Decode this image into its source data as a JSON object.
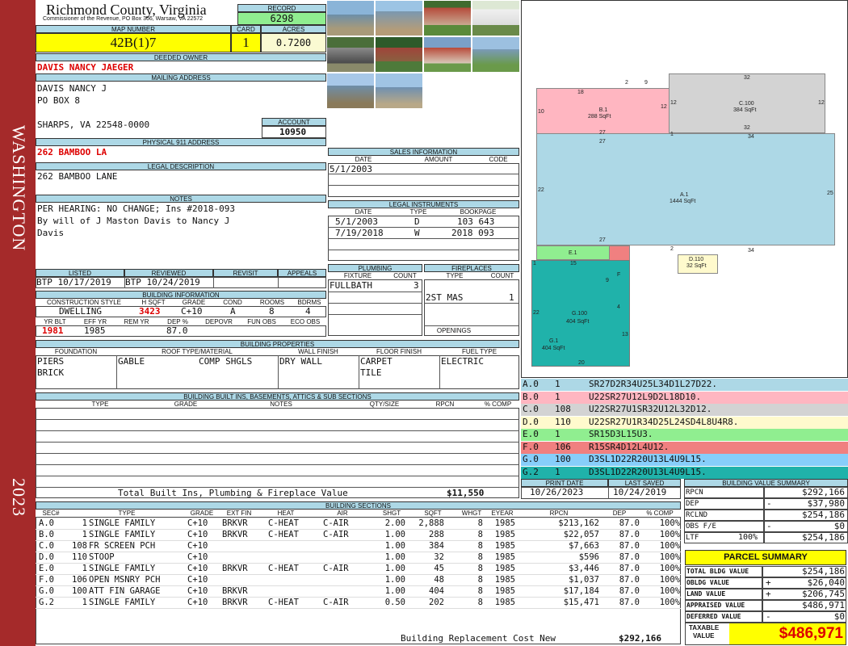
{
  "county": {
    "name": "Richmond County, Virginia",
    "address": "Commissioner of the Revenue, PO Box 366, Warsaw, VA 22572"
  },
  "side": {
    "district": "WASHINGTON",
    "year": "2023"
  },
  "record": {
    "label": "RECORD",
    "value": "6298"
  },
  "map": {
    "label": "MAP NUMBER",
    "value": "42B(1)7"
  },
  "card": {
    "label": "CARD",
    "value": "1"
  },
  "acres": {
    "label": "ACRES",
    "value": "0.7200"
  },
  "owner": {
    "label": "DEEDED OWNER",
    "value": "DAVIS NANCY JAEGER"
  },
  "mailing": {
    "label": "MAILING ADDRESS",
    "line1": "DAVIS NANCY J",
    "line2": "PO BOX 8",
    "line3": "SHARPS, VA 22548-0000"
  },
  "account": {
    "label": "ACCOUNT",
    "value": "10950"
  },
  "physical": {
    "label": "PHYSICAL 911 ADDRESS",
    "value": "262 BAMBOO LA"
  },
  "legal": {
    "label": "LEGAL DESCRIPTION",
    "value": "262 BAMBOO LANE"
  },
  "notes": {
    "label": "NOTES",
    "line1": "PER HEARING: NO CHANGE; Ins #2018-093",
    "line2": "By will of J Maston Davis to Nancy J",
    "line3": "Davis"
  },
  "sales": {
    "label": "SALES INFORMATION",
    "h_date": "DATE",
    "h_amount": "AMOUNT",
    "h_code": "CODE",
    "r1_date": "5/1/2003"
  },
  "instruments": {
    "label": "LEGAL INSTRUMENTS",
    "h_date": "DATE",
    "h_type": "TYPE",
    "h_bp": "BOOKPAGE",
    "rows": [
      {
        "date": "5/1/2003",
        "type": "D",
        "bp": "103 643"
      },
      {
        "date": "7/19/2018",
        "type": "W",
        "bp": "2018 093"
      }
    ]
  },
  "listed": {
    "label": "LISTED",
    "value": "BTP 10/17/2019"
  },
  "reviewed": {
    "label": "REVIEWED",
    "value": "BTP 10/24/2019"
  },
  "revisit": {
    "label": "REVISIT"
  },
  "appeals": {
    "label": "APPEALS"
  },
  "binfo": {
    "label": "BUILDING INFORMATION",
    "h_cs": "CONSTRUCTION STYLE",
    "h_sq": "H SQFT",
    "h_grade": "GRADE",
    "h_cond": "COND",
    "h_rooms": "ROOMS",
    "h_bdrms": "BDRMS",
    "cs": "DWELLING",
    "sq": "3423",
    "grade": "C+10",
    "cond": "A",
    "rooms": "8",
    "bdrms": "4",
    "h_yb": "YR BLT",
    "h_ey": "EFF YR",
    "h_rem": "REM YR",
    "h_dep": "DEP %",
    "h_depovr": "DEPOVR",
    "h_fun": "FUN OBS",
    "h_eco": "ECO OBS",
    "yb": "1981",
    "ey": "1985",
    "dep": "87.0"
  },
  "plumbing": {
    "label": "PLUMBING",
    "h_fixture": "FIXTURE",
    "h_count": "COUNT",
    "fixture": "FULLBATH",
    "count": "3"
  },
  "fireplaces": {
    "label": "FIREPLACES",
    "h_type": "TYPE",
    "h_count": "COUNT",
    "type": "2ST MAS",
    "count": "1",
    "openings": "OPENINGS"
  },
  "props": {
    "label": "BUILDING PROPERTIES",
    "h_found": "FOUNDATION",
    "h_roof": "ROOF TYPE/MATERIAL",
    "h_wall": "WALL FINISH",
    "h_floor": "FLOOR FINISH",
    "h_fuel": "FUEL TYPE",
    "found1": "PIERS",
    "found2": "BRICK",
    "roof1": "GABLE",
    "roof2": "COMP SHGLS",
    "wall": "DRY WALL",
    "floor1": "CARPET",
    "floor2": "TILE",
    "fuel": "ELECTRIC"
  },
  "builtins": {
    "label": "BUILDING BUILT INS, BASEMENTS, ATTICS & SUB SECTIONS",
    "h_type": "TYPE",
    "h_grade": "GRADE",
    "h_notes": "NOTES",
    "h_qty": "QTY/SIZE",
    "h_rpcn": "RPCN",
    "h_pc": "% COMP",
    "total_label": "Total Built Ins, Plumbing & Fireplace Value",
    "total": "$11,550"
  },
  "sketch": {
    "areas": [
      {
        "code": "B.1",
        "sqft": "288 SqFt"
      },
      {
        "code": "C.100",
        "sqft": "384 SqFt"
      },
      {
        "code": "A.1",
        "sqft": "1444 SqFt"
      },
      {
        "code": "D.110",
        "sqft": "32 SqFt"
      },
      {
        "code": "E.1",
        "sqft": ""
      },
      {
        "code": "F",
        "sqft": ""
      },
      {
        "code": "G.100",
        "sqft": "404 SqFt"
      },
      {
        "code": "G.1",
        "sqft": "404 SqFt"
      }
    ],
    "dims": [
      "18",
      "2",
      "9",
      "10",
      "12",
      "27",
      "32",
      "12",
      "12",
      "32",
      "1",
      "27",
      "34",
      "22",
      "25",
      "27",
      "2",
      "34",
      "1",
      "15",
      "9",
      "4",
      "22",
      "13",
      "20"
    ]
  },
  "segments": [
    {
      "code": "A.0",
      "num": "1",
      "desc": "SR27D2R34U25L34D1L27D22.",
      "color": "#add8e6"
    },
    {
      "code": "B.0",
      "num": "1",
      "desc": "U22SR27U12L9D2L18D10.",
      "color": "#ffb6c1"
    },
    {
      "code": "C.0",
      "num": "108",
      "desc": "U22SR27U1SR32U12L32D12.",
      "color": "#d3d3d3"
    },
    {
      "code": "D.0",
      "num": "110",
      "desc": "U22SR27U1R34D25L24SD4L8U4R8.",
      "color": "#fffacd"
    },
    {
      "code": "E.0",
      "num": "1",
      "desc": "SR15D3L15U3.",
      "color": "#90ee90"
    },
    {
      "code": "F.0",
      "num": "106",
      "desc": "R15SR4D12L4U12.",
      "color": "#f08080"
    },
    {
      "code": "G.0",
      "num": "100",
      "desc": "D3SL1D22R20U13L4U9L15.",
      "color": "#87cefa"
    },
    {
      "code": "G.2",
      "num": "1",
      "desc": "D3SL1D22R20U13L4U9L15.",
      "color": "#20b2aa"
    }
  ],
  "print": {
    "h_print": "PRINT DATE",
    "h_saved": "LAST SAVED",
    "print": "10/26/2023",
    "saved": "10/24/2019"
  },
  "bsum": {
    "label": "BUILDING VALUE SUMMARY",
    "rows": [
      {
        "k": "RPCN",
        "s": "",
        "p": "",
        "v": "$292,166"
      },
      {
        "k": "DEP",
        "s": "",
        "p": "-",
        "v": "$37,980"
      },
      {
        "k": "RCLND",
        "s": "",
        "p": "",
        "v": "$254,186"
      },
      {
        "k": "OBS F/E",
        "s": "",
        "p": "-",
        "v": "$0"
      },
      {
        "k": "LTF",
        "s": "100%",
        "p": "",
        "v": "$254,186"
      }
    ]
  },
  "parcel": {
    "label": "PARCEL SUMMARY",
    "rows": [
      {
        "k": "TOTAL BLDG VALUE",
        "p": "",
        "v": "$254,186"
      },
      {
        "k": "OBLDG VALUE",
        "p": "+",
        "v": "$26,040"
      },
      {
        "k": "LAND VALUE",
        "p": "+",
        "v": "$206,745"
      },
      {
        "k": "APPRAISED VALUE",
        "p": "",
        "v": "$486,971"
      },
      {
        "k": "DEFERRED VALUE",
        "p": "-",
        "v": "$0"
      }
    ],
    "taxable_l1": "TAXABLE",
    "taxable_l2": "VALUE",
    "taxable": "$486,971"
  },
  "sections": {
    "label": "BUILDING SECTIONS",
    "headers": [
      "SEC#",
      "TYPE",
      "GRADE",
      "EXT FIN",
      "HEAT",
      "AIR",
      "SHGT",
      "SQFT",
      "WHGT",
      "EYEAR",
      "RPCN",
      "DEP",
      "% COMP"
    ],
    "rows": [
      [
        "A.0",
        "1",
        "SINGLE FAMILY",
        "C+10",
        "BRKVR",
        "C-HEAT",
        "C-AIR",
        "2.00",
        "2,888",
        "8",
        "1985",
        "$213,162",
        "87.0",
        "100%"
      ],
      [
        "B.0",
        "1",
        "SINGLE FAMILY",
        "C+10",
        "BRKVR",
        "C-HEAT",
        "C-AIR",
        "1.00",
        "288",
        "8",
        "1985",
        "$22,057",
        "87.0",
        "100%"
      ],
      [
        "C.0",
        "108",
        "FR SCREEN PCH",
        "C+10",
        "",
        "",
        "",
        "1.00",
        "384",
        "8",
        "1985",
        "$7,663",
        "87.0",
        "100%"
      ],
      [
        "D.0",
        "110",
        "STOOP",
        "C+10",
        "",
        "",
        "",
        "1.00",
        "32",
        "8",
        "1985",
        "$596",
        "87.0",
        "100%"
      ],
      [
        "E.0",
        "1",
        "SINGLE FAMILY",
        "C+10",
        "BRKVR",
        "C-HEAT",
        "C-AIR",
        "1.00",
        "45",
        "8",
        "1985",
        "$3,446",
        "87.0",
        "100%"
      ],
      [
        "F.0",
        "106",
        "OPEN MSNRY PCH",
        "C+10",
        "",
        "",
        "",
        "1.00",
        "48",
        "8",
        "1985",
        "$1,037",
        "87.0",
        "100%"
      ],
      [
        "G.0",
        "100",
        "ATT FIN GARAGE",
        "C+10",
        "BRKVR",
        "",
        "",
        "1.00",
        "404",
        "8",
        "1985",
        "$17,184",
        "87.0",
        "100%"
      ],
      [
        "G.2",
        "1",
        "SINGLE FAMILY",
        "C+10",
        "BRKVR",
        "C-HEAT",
        "C-AIR",
        "0.50",
        "202",
        "8",
        "1985",
        "$15,471",
        "87.0",
        "100%"
      ]
    ],
    "rcn_label": "Building Replacement Cost New",
    "rcn": "$292,166"
  },
  "photos": [
    "photo-pier",
    "photo-house",
    "photo-shed",
    "photo-cars",
    "photo-house-rear",
    "photo-deck",
    "photo-waterfront",
    "photo-walkway",
    "photo-shoreline",
    "photo-boathouse"
  ]
}
